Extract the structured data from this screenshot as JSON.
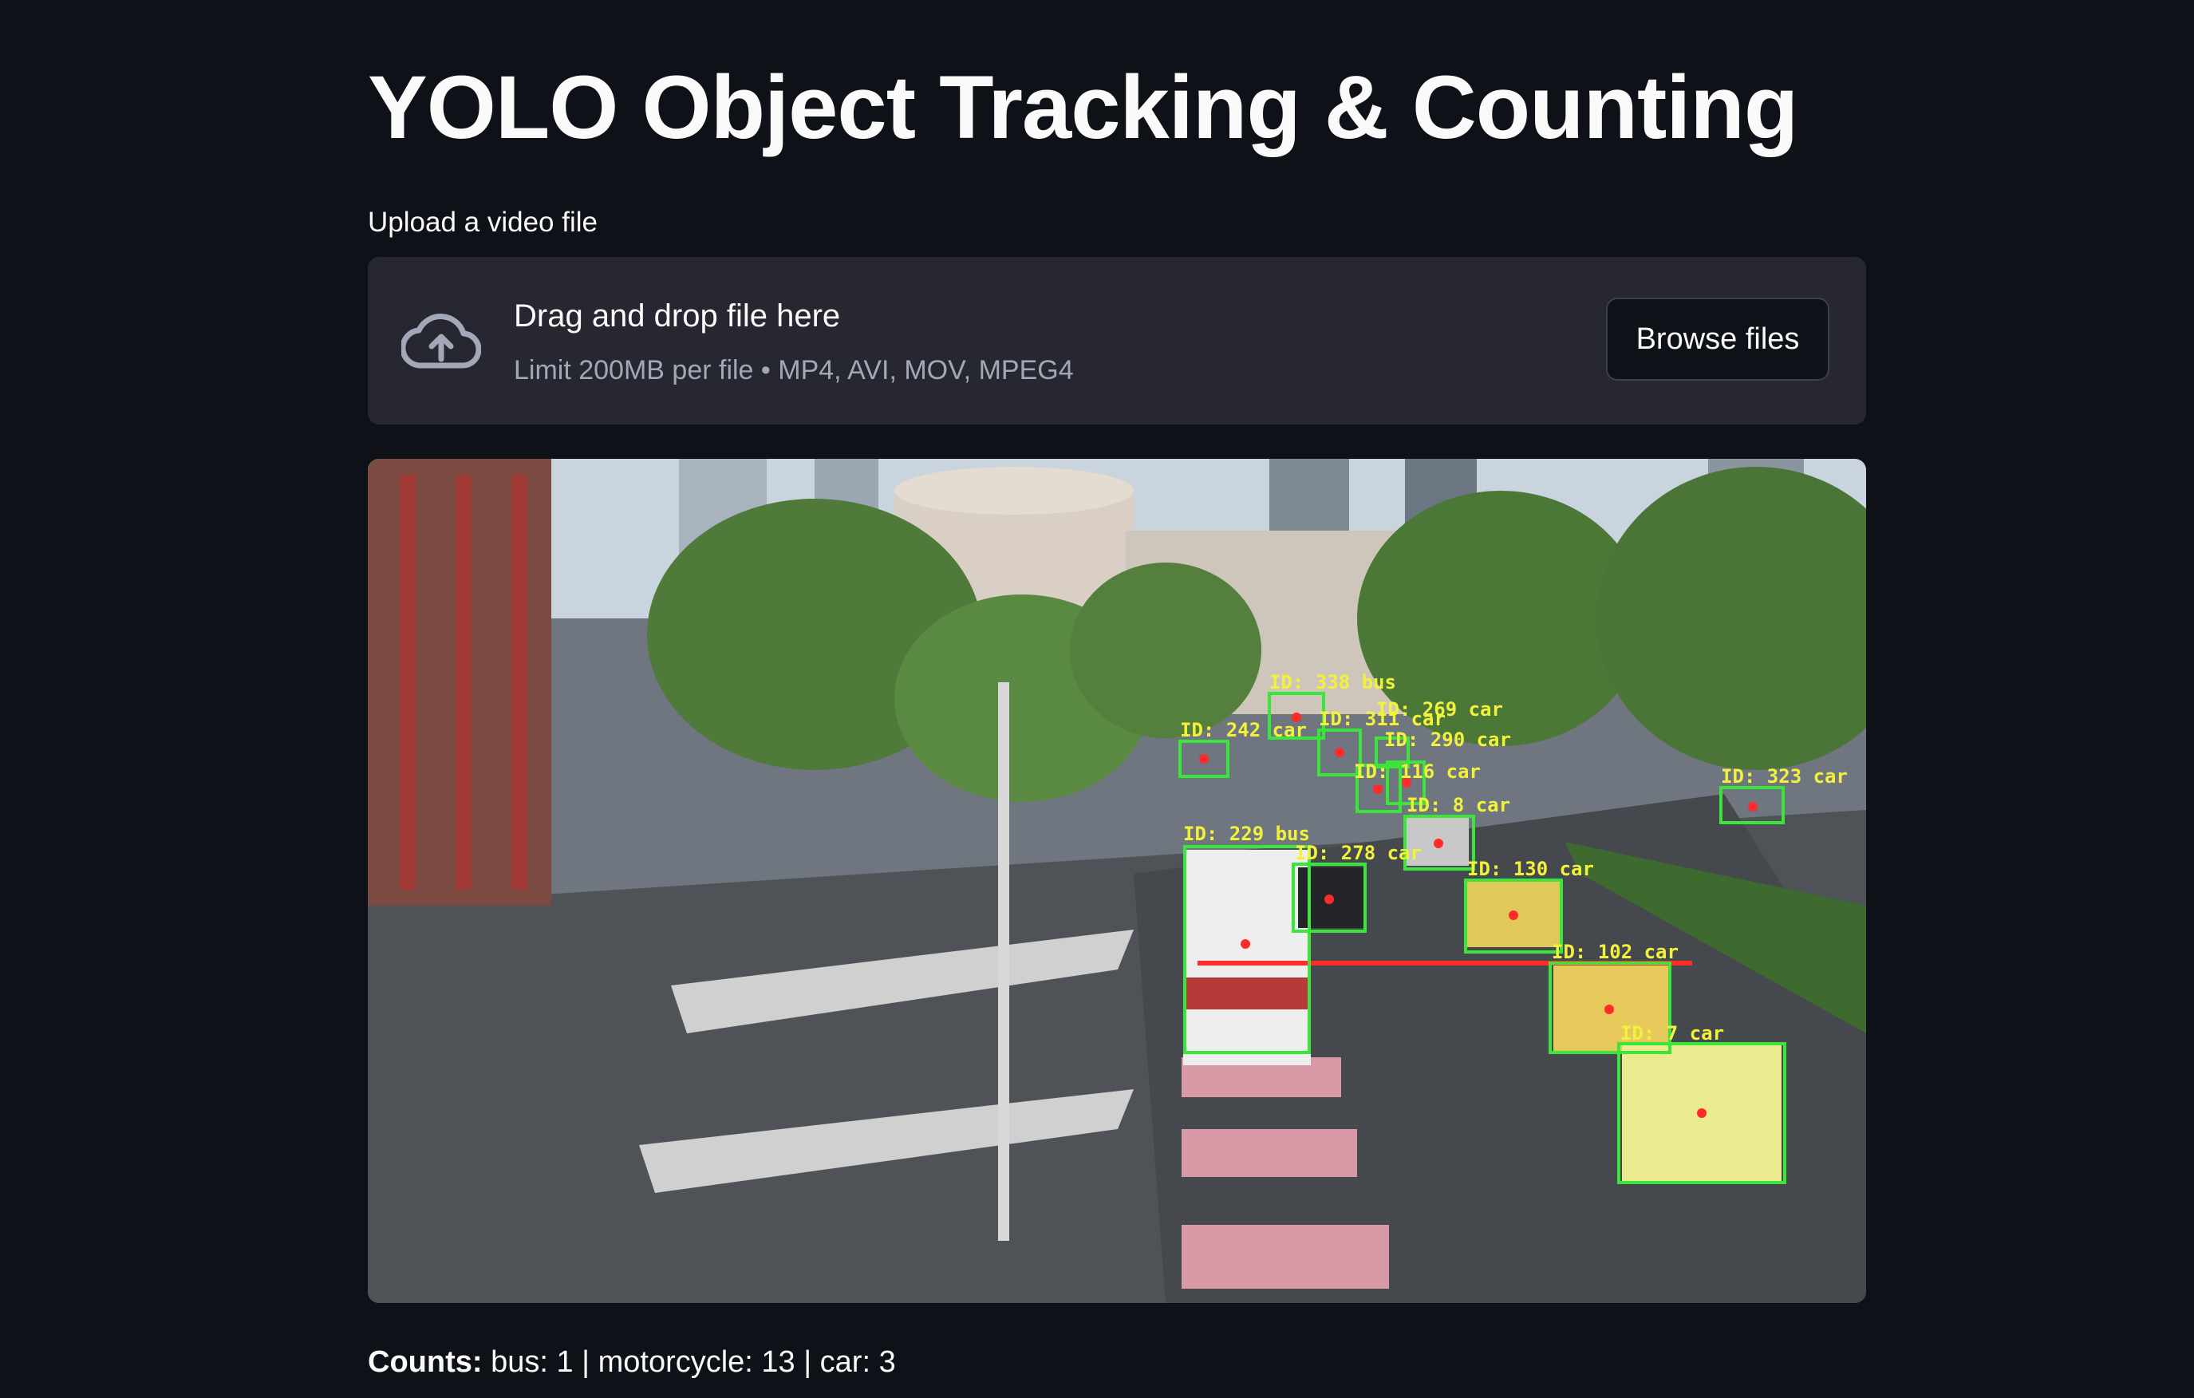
{
  "title": "YOLO Object Tracking & Counting",
  "uploader": {
    "label": "Upload a video file",
    "drop_text": "Drag and drop file here",
    "limit_text": "Limit 200MB per file • MP4, AVI, MOV, MPEG4",
    "browse_label": "Browse files",
    "icon": "cloud-upload-icon"
  },
  "video": {
    "detections": [
      {
        "label": "ID: 338 bus"
      },
      {
        "label": "ID: 242 car"
      },
      {
        "label": "ID: 311 car"
      },
      {
        "label": "ID: 269 car"
      },
      {
        "label": "ID: 290 car"
      },
      {
        "label": "ID: 116 car"
      },
      {
        "label": "ID: 8 car"
      },
      {
        "label": "ID: 323 car"
      },
      {
        "label": "ID: 229 bus"
      },
      {
        "label": "ID: 278 car"
      },
      {
        "label": "ID: 130 car"
      },
      {
        "label": "ID: 102 car"
      },
      {
        "label": "ID: 7 car"
      }
    ],
    "box_color": "#39e639",
    "label_color": "#f2f23a",
    "line_color": "#ff2a2a"
  },
  "counts": {
    "label": "Counts:",
    "value": "bus: 1 | motorcycle: 13 | car: 3"
  }
}
